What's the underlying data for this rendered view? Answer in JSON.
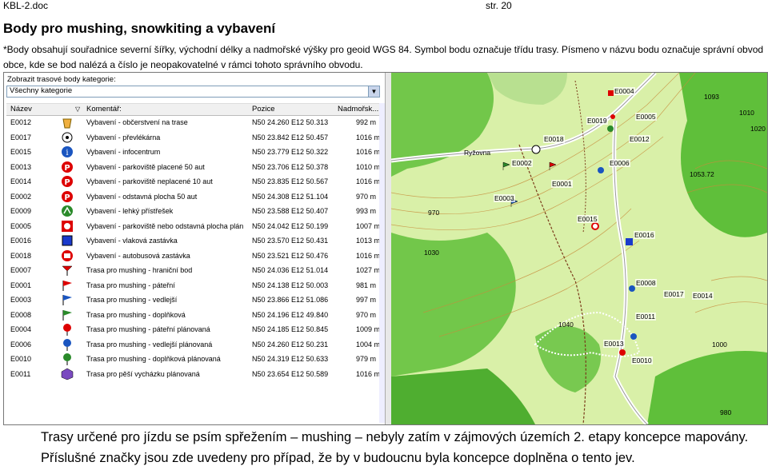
{
  "header": {
    "filename": "KBL-2.doc",
    "page": "str. 20"
  },
  "title": "Body pro mushing, snowkiting a vybavení",
  "intro": "*Body obsahují souřadnice severní šířky, východní délky a nadmořské výšky pro geoid WGS 84. Symbol bodu označuje třídu trasy. Písmeno v názvu bodu označuje správní obvod obce, kde se bod nalézá a číslo je neopakovatelné v rámci tohoto správního obvodu.",
  "panel": {
    "filter_label": "Zobrazit trasové body kategorie:",
    "filter_value": "Všechny kategorie",
    "columns": {
      "name": "Název",
      "comment": "Komentář:",
      "position": "Pozice",
      "altitude": "Nadmořsk..."
    },
    "rows": [
      {
        "name": "E0012",
        "icon": "bucket-icon",
        "comment": "Vybavení - občerstvení na trase",
        "position": "N50 24.260 E12 50.313",
        "altitude": "992 m"
      },
      {
        "name": "E0017",
        "icon": "laundry-icon",
        "comment": "Vybavení - převlékárna",
        "position": "N50 23.842 E12 50.457",
        "altitude": "1016 m"
      },
      {
        "name": "E0015",
        "icon": "info-icon",
        "comment": "Vybavení - infocentrum",
        "position": "N50 23.779 E12 50.322",
        "altitude": "1016 m"
      },
      {
        "name": "E0013",
        "icon": "parking-icon",
        "comment": "Vybavení - parkoviště placené 50 aut",
        "position": "N50 23.706 E12 50.378",
        "altitude": "1010 m"
      },
      {
        "name": "E0014",
        "icon": "parking-icon",
        "comment": "Vybavení - parkoviště neplacené 10 aut",
        "position": "N50 23.835 E12 50.567",
        "altitude": "1016 m"
      },
      {
        "name": "E0002",
        "icon": "parking-icon",
        "comment": "Vybavení - odstavná plocha 50 aut",
        "position": "N50 24.308 E12 51.104",
        "altitude": "970 m"
      },
      {
        "name": "E0009",
        "icon": "shelter-icon",
        "comment": "Vybavení - lehký přístřešek",
        "position": "N50 23.588 E12 50.407",
        "altitude": "993 m"
      },
      {
        "name": "E0005",
        "icon": "no-parking-icon",
        "comment": "Vybavení - parkoviště nebo odstavná plocha plán...",
        "position": "N50 24.042 E12 50.199",
        "altitude": "1007 m"
      },
      {
        "name": "E0016",
        "icon": "train-icon",
        "comment": "Vybavení - vlaková zastávka",
        "position": "N50 23.570 E12 50.431",
        "altitude": "1013 m"
      },
      {
        "name": "E0018",
        "icon": "bus-icon",
        "comment": "Vybavení - autobusová zastávka",
        "position": "N50 23.521 E12 50.476",
        "altitude": "1016 m"
      },
      {
        "name": "E0007",
        "icon": "boundary-flag-icon",
        "comment": "Trasa pro mushing - hraniční bod",
        "position": "N50 24.036 E12 51.014",
        "altitude": "1027 m"
      },
      {
        "name": "E0001",
        "icon": "red-flag-icon",
        "comment": "Trasa pro mushing - páteřní",
        "position": "N50 24.138 E12 50.003",
        "altitude": "981 m"
      },
      {
        "name": "E0003",
        "icon": "blue-flag-icon",
        "comment": "Trasa pro mushing - vedlejší",
        "position": "N50 23.866 E12 51.086",
        "altitude": "997 m"
      },
      {
        "name": "E0008",
        "icon": "green-flag-icon",
        "comment": "Trasa pro mushing - doplňková",
        "position": "N50 24.196 E12 49.840",
        "altitude": "970 m"
      },
      {
        "name": "E0004",
        "icon": "red-pin-icon",
        "comment": "Trasa pro mushing - páteřní plánovaná",
        "position": "N50 24.185 E12 50.845",
        "altitude": "1009 m"
      },
      {
        "name": "E0006",
        "icon": "blue-pin-icon",
        "comment": "Trasa pro mushing - vedlejší plánovaná",
        "position": "N50 24.260 E12 50.231",
        "altitude": "1004 m"
      },
      {
        "name": "E0010",
        "icon": "green-pin-icon",
        "comment": "Trasa pro mushing - doplňková plánovaná",
        "position": "N50 24.319 E12 50.633",
        "altitude": "979 m"
      },
      {
        "name": "E0011",
        "icon": "purple-cube-icon",
        "comment": "Trasa pro pěší vycházku plánovaná",
        "position": "N50 23.654 E12 50.589",
        "altitude": "1016 m"
      }
    ]
  },
  "map": {
    "labels": {
      "road": "Ryžovna",
      "e4": "E0004",
      "e19": "E0019",
      "e5": "E0005",
      "e18": "E0018",
      "e12": "E0012",
      "e2": "E0002",
      "e6": "E0006",
      "e1": "E0001",
      "e3": "E0003",
      "e15": "E0015",
      "e16": "E0016",
      "e8": "E0008",
      "e17": "E0017",
      "e14": "E0014",
      "e11": "E0011",
      "e13": "E0013",
      "e10": "E0010",
      "h1093": "1093",
      "h1010": "1010",
      "h1020": "1020",
      "h1053": "1053.72",
      "h1040": "1040",
      "h1000": "1000",
      "h970": "970",
      "h1030": "1030",
      "h980": "980"
    },
    "colors": {
      "forest": "#5fbf3a",
      "meadow": "#d9f0a8",
      "road": "#b0b0b0"
    }
  },
  "captions": {
    "line1": "Trasy určené pro jízdu se psím spřežením – mushing – nebyly zatím v zájmových územích 2. etapy koncepce mapovány.",
    "line2": "Příslušné značky jsou zde uvedeny pro případ, že by v budoucnu byla koncepce doplněna o tento jev."
  }
}
